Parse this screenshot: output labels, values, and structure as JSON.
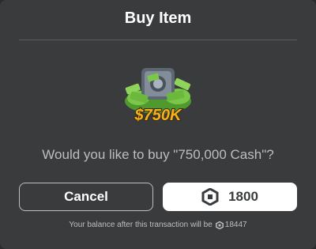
{
  "dialog": {
    "title": "Buy Item",
    "item_name_badge": "$750K",
    "question": "Would you like to buy \"750,000 Cash\"?",
    "cancel_label": "Cancel",
    "price": "1800",
    "balance_text": "Your balance after this transaction will be",
    "balance_after": "18447"
  },
  "icons": {
    "item_image": "money-vault-image",
    "currency": "robux-icon"
  },
  "colors": {
    "background": "#393b3d",
    "text_primary": "#ffffff",
    "text_secondary": "#bdbebe",
    "buy_button_bg": "#ffffff",
    "badge_gold": "#f5b21b"
  }
}
